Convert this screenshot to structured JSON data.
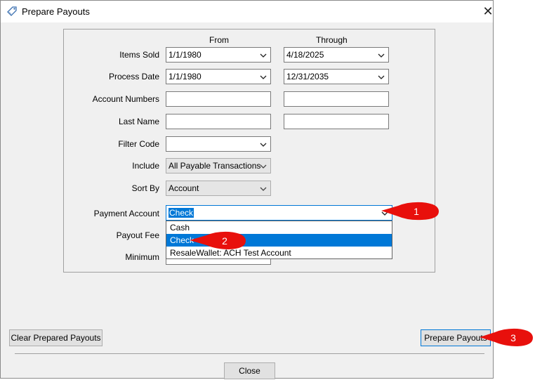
{
  "window": {
    "title": "Prepare Payouts"
  },
  "columns": {
    "from": "From",
    "through": "Through"
  },
  "fields": {
    "items_sold": {
      "label": "Items Sold",
      "from": "1/1/1980",
      "through": "4/18/2025"
    },
    "process_date": {
      "label": "Process Date",
      "from": "1/1/1980",
      "through": "12/31/2035"
    },
    "account_numbers": {
      "label": "Account Numbers",
      "from": "",
      "through": ""
    },
    "last_name": {
      "label": "Last Name",
      "from": "",
      "through": ""
    },
    "filter_code": {
      "label": "Filter Code",
      "value": ""
    },
    "include": {
      "label": "Include",
      "value": "All Payable Transactions"
    },
    "sort_by": {
      "label": "Sort By",
      "value": "Account"
    },
    "payment_account": {
      "label": "Payment Account",
      "value": "Check",
      "options": [
        "Cash",
        "Check",
        "ResaleWallet: ACH Test Account"
      ],
      "selected_index": 1
    },
    "payout_fee": {
      "label": "Payout Fee"
    },
    "minimum": {
      "label": "Minimum"
    }
  },
  "buttons": {
    "clear": "Clear Prepared Payouts",
    "prepare": "Prepare Payouts",
    "close": "Close"
  },
  "callouts": [
    "1",
    "2",
    "3"
  ],
  "colors": {
    "selection": "#0078d7",
    "callout": "#e8100c"
  },
  "icons": {
    "title": "tag-icon",
    "close": "close-icon",
    "dropdown": "chevron-down-icon"
  }
}
